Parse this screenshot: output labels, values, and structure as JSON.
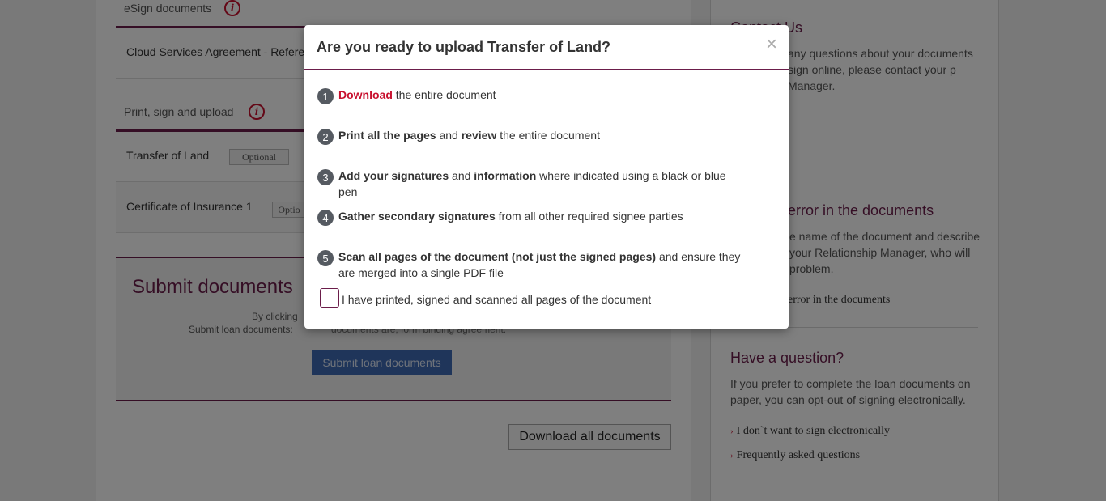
{
  "main": {
    "esign_heading": "eSign documents",
    "esign_docs": [
      {
        "name": "Cloud Services Agreement - Refere"
      }
    ],
    "print_heading": "Print, sign and upload",
    "print_docs": [
      {
        "name": "Transfer of Land",
        "badge": "Optional"
      },
      {
        "name": "Certificate of Insurance 1",
        "badge": "Optio"
      }
    ],
    "submit": {
      "title": "Submit documents",
      "label1": "By clicking",
      "label2": "Submit loan documents:",
      "clipped_text": "documents are, form binding agreement.",
      "button": "Submit loan documents"
    },
    "download_all": "Download all documents"
  },
  "side": {
    "contact_heading": "Contact Us",
    "contact_text": "any questions about your documents sign online, please contact your p Manager.",
    "error_heading": "n error in the documents",
    "error_text": "e name of the document and describe your Relationship Manager, who will problem.",
    "error_link": "error in the documents",
    "question_heading": "Have a question?",
    "question_text": "If you prefer to complete the loan documents on paper, you can opt-out of signing electronically.",
    "links": [
      "I don`t want to sign electronically",
      "Frequently asked questions"
    ]
  },
  "modal": {
    "title": "Are you ready to upload Transfer of Land?",
    "close": "×",
    "steps": [
      {
        "num": "1",
        "parts": [
          {
            "t": "Download",
            "s": "red"
          },
          {
            "t": " the entire document",
            "s": ""
          }
        ]
      },
      {
        "num": "2",
        "parts": [
          {
            "t": "Print all the pages",
            "s": "b"
          },
          {
            "t": " and ",
            "s": ""
          },
          {
            "t": "review",
            "s": "b"
          },
          {
            "t": " the entire document",
            "s": ""
          }
        ]
      },
      {
        "num": "3",
        "parts": [
          {
            "t": "Add your signatures",
            "s": "b"
          },
          {
            "t": " and ",
            "s": ""
          },
          {
            "t": "information",
            "s": "b"
          },
          {
            "t": " where indicated using a black or blue pen",
            "s": ""
          }
        ]
      },
      {
        "num": "4",
        "parts": [
          {
            "t": "Gather secondary signatures",
            "s": "b"
          },
          {
            "t": " from all other required signee parties",
            "s": ""
          }
        ]
      },
      {
        "num": "5",
        "parts": [
          {
            "t": "Scan all pages of the document (not just the signed pages)",
            "s": "b"
          },
          {
            "t": " and ensure they are merged into a single PDF file",
            "s": ""
          }
        ]
      }
    ],
    "confirm_label": "I have printed, signed and scanned all pages of the document"
  }
}
